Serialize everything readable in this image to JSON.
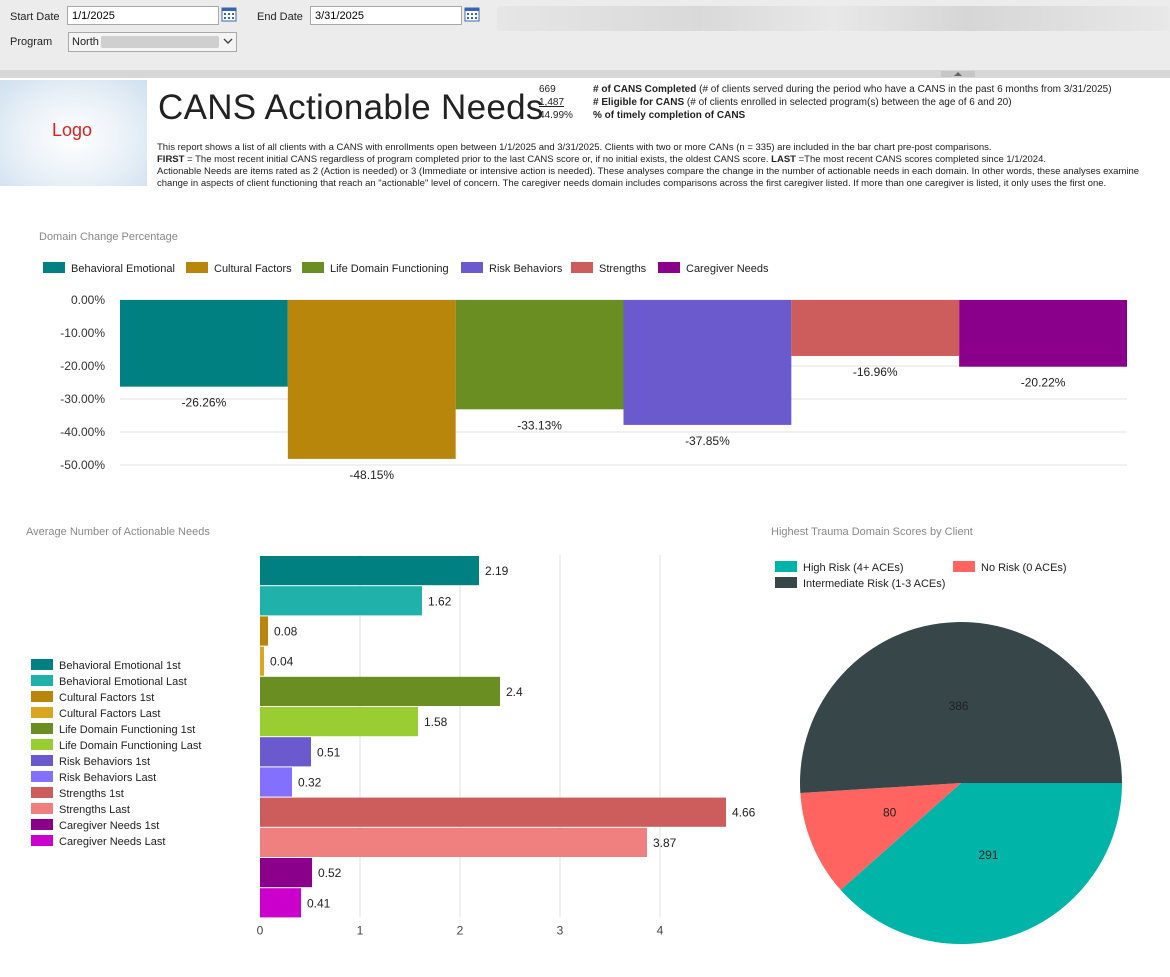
{
  "filters": {
    "start_date_label": "Start Date",
    "start_date_value": "1/1/2025",
    "end_date_label": "End Date",
    "end_date_value": "3/31/2025",
    "program_label": "Program",
    "program_value": "North"
  },
  "header": {
    "logo_text": "Logo",
    "title": "CANS Actionable Needs",
    "stats": [
      {
        "value": "669",
        "bold": "# of CANS Completed",
        "text": " (# of clients served during the period who have a CANS in the past 6 months from 3/31/2025)"
      },
      {
        "value": "1,487",
        "bold": "# Eligible for CANS",
        "text": " (# of clients enrolled in selected program(s) between the age of 6 and 20)"
      },
      {
        "value": "44.99%",
        "bold": "% of timely completion of CANS",
        "text": ""
      }
    ],
    "desc_line1": "This report shows a list of all clients with a CANS with enrollments open between 1/1/2025 and 3/31/2025. Clients with two or more CANs (n = 335) are included in the bar chart pre-post comparisons.",
    "desc_first_bold": "FIRST",
    "desc_first_text": " = The most recent initial CANS regardless of program completed prior to the last CANS score or, if no initial exists, the oldest CANS score. ",
    "desc_last_bold": "LAST",
    "desc_last_text": " =The most recent CANS scores completed since 1/1/2024.",
    "desc_rest": "Actionable Needs are items rated as 2 (Action is needed) or 3 (Immediate or intensive action is needed). These analyses compare the change in the number of actionable needs in each domain. In other words, these analyses examine change in aspects of client functioning that reach an \"actionable\" level of concern. The caregiver needs domain includes comparisons across the first caregiver listed. If more than one caregiver is listed, it only uses the first one."
  },
  "chart_data": [
    {
      "type": "bar",
      "title": "Domain Change Percentage",
      "categories": [
        "Behavioral Emotional",
        "Cultural Factors",
        "Life Domain Functioning",
        "Risk Behaviors",
        "Strengths",
        "Caregiver Needs"
      ],
      "values": [
        -26.26,
        -48.15,
        -33.13,
        -37.85,
        -16.96,
        -20.22
      ],
      "value_labels": [
        "-26.26%",
        "-48.15%",
        "-33.13%",
        "-37.85%",
        "-16.96%",
        "-20.22%"
      ],
      "colors": [
        "#008080",
        "#b8860b",
        "#6b8e23",
        "#6a5acd",
        "#cd5c5c",
        "#8b008b"
      ],
      "ylim": [
        -50,
        0
      ],
      "yticks": [
        "0.00%",
        "-10.00%",
        "-20.00%",
        "-30.00%",
        "-40.00%",
        "-50.00%"
      ],
      "legend_position": "top-left",
      "grid": true
    },
    {
      "type": "bar",
      "orientation": "horizontal",
      "title": "Average Number of Actionable Needs",
      "categories": [
        "Behavioral Emotional 1st",
        "Behavioral Emotional Last",
        "Cultural Factors 1st",
        "Cultural Factors Last",
        "Life Domain Functioning 1st",
        "Life Domain Functioning Last",
        "Risk Behaviors 1st",
        "Risk Behaviors Last",
        "Strengths 1st",
        "Strengths Last",
        "Caregiver Needs 1st",
        "Caregiver Needs Last"
      ],
      "values": [
        2.19,
        1.62,
        0.08,
        0.04,
        2.4,
        1.58,
        0.51,
        0.32,
        4.66,
        3.87,
        0.52,
        0.41
      ],
      "value_labels": [
        "2.19",
        "1.62",
        "0.08",
        "0.04",
        "2.4",
        "1.58",
        "0.51",
        "0.32",
        "4.66",
        "3.87",
        "0.52",
        "0.41"
      ],
      "colors": [
        "#008080",
        "#20b2aa",
        "#b8860b",
        "#daa520",
        "#6b8e23",
        "#9acd32",
        "#6a5acd",
        "#8470ff",
        "#cd5c5c",
        "#f08080",
        "#8b008b",
        "#cc00cc"
      ],
      "xlim": [
        0,
        4.7
      ],
      "xticks": [
        "0",
        "1",
        "2",
        "3",
        "4"
      ],
      "legend_position": "left",
      "grid": true
    },
    {
      "type": "pie",
      "title": "Highest Trauma Domain Scores by Client",
      "categories": [
        "High Risk (4+ ACEs)",
        "No Risk (0 ACEs)",
        "Intermediate Risk (1-3 ACEs)"
      ],
      "values": [
        291,
        80,
        386
      ],
      "value_labels": [
        "291",
        "80",
        "386"
      ],
      "colors": [
        "#00b5a8",
        "#ff6461",
        "#374649"
      ],
      "legend_position": "top-left"
    }
  ]
}
